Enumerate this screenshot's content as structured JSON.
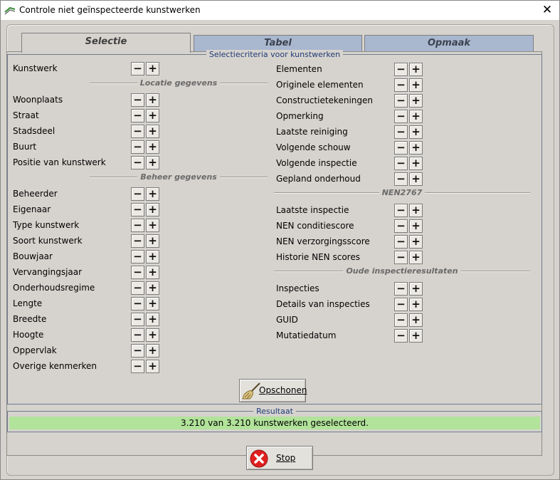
{
  "window": {
    "title": "Controle niet geïnspecteerde kunstwerken",
    "close_label": "✕"
  },
  "tabs": [
    {
      "label": "Selectie",
      "active": true
    },
    {
      "label": "Tabel",
      "active": false
    },
    {
      "label": "Opmaak",
      "active": false
    }
  ],
  "criteria": {
    "legend": "Selectiecriteria voor kunstwerken",
    "minus": "−",
    "plus": "+",
    "left": {
      "top_item": "Kunstwerk",
      "section1_title": "Locatie gegevens",
      "section1_items": [
        "Woonplaats",
        "Straat",
        "Stadsdeel",
        "Buurt",
        "Positie van kunstwerk"
      ],
      "section2_title": "Beheer gegevens",
      "section2_items": [
        "Beheerder",
        "Eigenaar",
        "Type kunstwerk",
        "Soort kunstwerk",
        "Bouwjaar",
        "Vervangingsjaar",
        "Onderhoudsregime",
        "Lengte",
        "Breedte",
        "Hoogte",
        "Oppervlak",
        "Overige kenmerken"
      ]
    },
    "right": {
      "group1_items": [
        "Elementen",
        "Originele elementen",
        "Constructietekeningen",
        "Opmerking",
        "Laatste reiniging",
        "Volgende schouw",
        "Volgende inspectie",
        "Gepland onderhoud"
      ],
      "section3_title": "NEN2767",
      "section3_items": [
        "Laatste inspectie",
        "NEN conditiescore",
        "NEN verzorgingsscore",
        "Historie NEN scores"
      ],
      "section4_title": "Oude inspectieresultaten",
      "section4_items": [
        "Inspecties",
        "Details van inspecties",
        "GUID",
        "Mutatiedatum"
      ]
    },
    "clear_button": "Opschonen"
  },
  "result": {
    "legend": "Resultaat",
    "text": "3.210 van 3.210 kunstwerken geselecteerd."
  },
  "stop_button": "Stop",
  "colors": {
    "result_bg": "#b1e39a",
    "inactive_tab": "#a9b7cf",
    "stop_red": "#e02020"
  }
}
